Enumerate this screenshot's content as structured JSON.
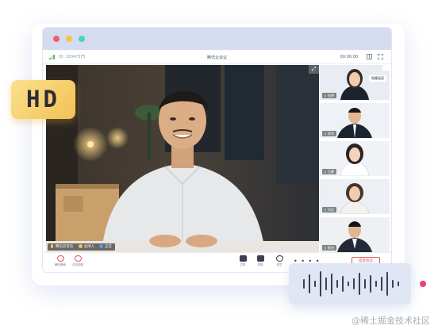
{
  "meeting": {
    "id_text": "ID: 1034?375",
    "title": "腾讯云会议",
    "timer": "00:00:00"
  },
  "main_speaker": {
    "name_label": "腾讯云音乐",
    "badge_1": "主持人",
    "badge_2": "正在"
  },
  "sidebar": {
    "hide_label": "隐藏画面",
    "participants": [
      {
        "name": "张明",
        "avatar": "woman-long-hair"
      },
      {
        "name": "李华",
        "avatar": "man-suit"
      },
      {
        "name": "王静",
        "avatar": "woman-white-blouse"
      },
      {
        "name": "刘芳",
        "avatar": "woman-bob"
      },
      {
        "name": "陈杰",
        "avatar": "man-suit-2"
      }
    ]
  },
  "toolbar": {
    "mute_label": "解除静音",
    "video_label": "开启视频",
    "share_label": "共享",
    "record_label": "录制",
    "members_label": "成员",
    "more_label": "• • • •",
    "leave_label": "结束会议"
  },
  "badge": {
    "hd": "HD"
  },
  "watermark": "@稀土掘金技术社区",
  "colors": {
    "chrome": "#d6dcef",
    "accent_red": "#e05a5a",
    "hd_gold": "#f2c155",
    "voice_card": "#e1e6f4",
    "pink_dot": "#f23e6e"
  }
}
